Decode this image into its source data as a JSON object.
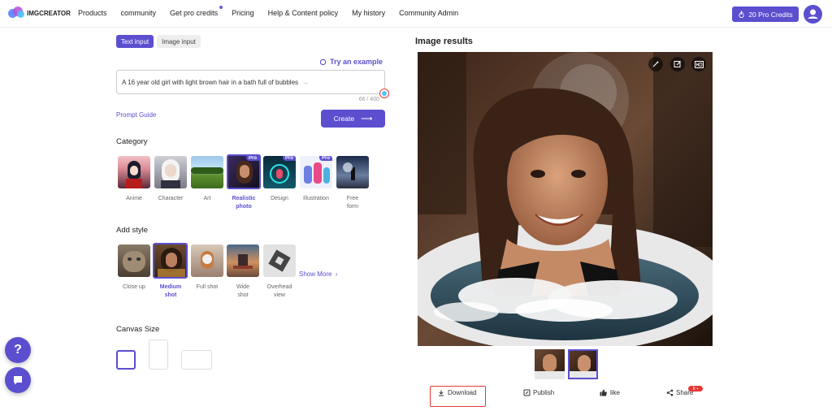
{
  "header": {
    "logo_text": "IMGCREATOR",
    "nav": [
      "Products",
      "community",
      "Get pro credits",
      "Pricing",
      "Help & Content policy",
      "My history",
      "Community Admin"
    ],
    "credits_label": "20 Pro Credits"
  },
  "input": {
    "tabs": [
      "Text input",
      "Image input"
    ],
    "try_example": "Try an example",
    "prompt_value": "A 16 year old girl with light brown hair in a bath full of bubbles",
    "counter": "66 / 400",
    "prompt_guide": "Prompt Guide",
    "create_label": "Create"
  },
  "category": {
    "title": "Category",
    "selected": "Realistic photo",
    "pro_badge": "Pro",
    "items": [
      {
        "label": "Anime",
        "pro": false
      },
      {
        "label": "Character",
        "pro": false
      },
      {
        "label": "Art",
        "pro": false
      },
      {
        "label": "Realistic photo",
        "pro": true
      },
      {
        "label": "Design",
        "pro": true
      },
      {
        "label": "Illustration",
        "pro": true
      },
      {
        "label": "Free form",
        "pro": false
      }
    ]
  },
  "style": {
    "title": "Add style",
    "selected": "Medium shot",
    "items": [
      "Close up",
      "Medium shot",
      "Full shot",
      "Wide shot",
      "Overhead view"
    ],
    "show_more": "Show More"
  },
  "canvas": {
    "title": "Canvas Size",
    "options": [
      "square",
      "portrait",
      "landscape"
    ],
    "selected": "square"
  },
  "results": {
    "title": "Image results",
    "tools": [
      "magic-wand-icon",
      "edit-icon",
      "hd-icon"
    ],
    "thumbnails": 2,
    "selected_thumbnail": 2,
    "actions": {
      "download": "Download",
      "publish": "Publish",
      "like": "like",
      "share": "Share"
    },
    "share_badge": "8"
  },
  "colors": {
    "accent": "#5b4fcf",
    "highlight": "#e53935"
  }
}
